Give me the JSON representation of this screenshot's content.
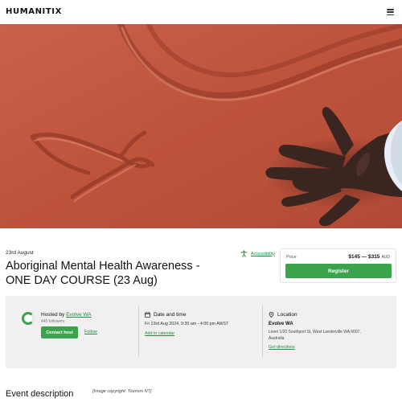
{
  "header": {
    "logo_text": "HUMANITIX",
    "menu_icon": "hamburger-menu-icon"
  },
  "hero": {
    "image": "red desert sand with hand drawing and hand print"
  },
  "event": {
    "date_label": "23rd August",
    "title": "Aboriginal Mental Health Awareness - ONE DAY COURSE (23 Aug)",
    "accessibility_label": "Accessibility"
  },
  "price": {
    "label": "Price",
    "range": "$145 — $315",
    "currency": "AUD",
    "register_label": "Register"
  },
  "host": {
    "prefix": "Hosted by ",
    "name": "Evolve WA",
    "followers": "445 followers",
    "contact_label": "Contact host",
    "follow_label": "Follow"
  },
  "datetime": {
    "heading": "Date and time",
    "value": "Fri 23rd Aug 2024, 9:30 am - 4:00 pm AWST",
    "add_calendar_label": "Add to calendar"
  },
  "location": {
    "heading": "Location",
    "venue": "Evolve WA",
    "address": "Level 1/20 Southport St, West Leederville WA 6007, Australia",
    "directions_label": "Get directions"
  },
  "description": {
    "heading": "Event description",
    "image_credit": "[Image copyright: Tourism NT]"
  },
  "colors": {
    "accent": "#3aa34b",
    "link": "#2e8540",
    "panel_bg": "#f0f0f0",
    "hero_sand": "#c0553e"
  }
}
